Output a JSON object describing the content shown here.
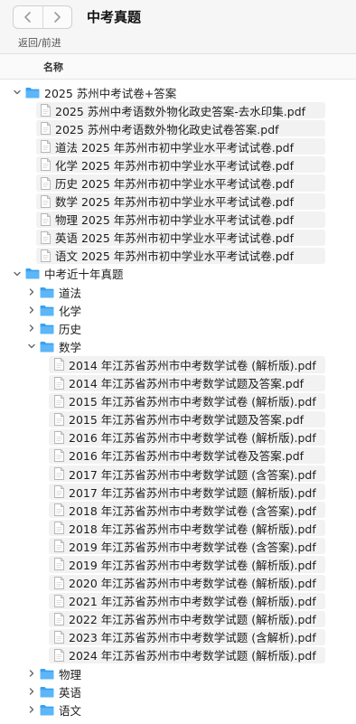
{
  "window": {
    "title": "中考真题",
    "nav_caption": "返回/前进"
  },
  "columns": {
    "name": "名称"
  },
  "icons": {
    "back": "chevron-left-icon",
    "forward": "chevron-right-icon",
    "folder": "folder-icon",
    "file": "pdf-file-icon",
    "expanded": "chevron-down-icon",
    "collapsed": "chevron-right-icon"
  },
  "colors": {
    "folder": "#3aa0f0",
    "stripe": "#f2f2f2"
  },
  "rows": [
    {
      "level": 0,
      "type": "folder",
      "expanded": true,
      "label": "2025 苏州中考试卷+答案"
    },
    {
      "level": 1,
      "type": "file",
      "label": "2025 苏州中考语数外物化政史答案-去水印集.pdf"
    },
    {
      "level": 1,
      "type": "file",
      "label": "2025 苏州中考语数外物化政史试卷答案.pdf"
    },
    {
      "level": 1,
      "type": "file",
      "label": "道法 2025 年苏州市初中学业水平考试试卷.pdf"
    },
    {
      "level": 1,
      "type": "file",
      "label": "化学 2025 年苏州市初中学业水平考试试卷.pdf"
    },
    {
      "level": 1,
      "type": "file",
      "label": "历史 2025 年苏州市初中学业水平考试试卷.pdf"
    },
    {
      "level": 1,
      "type": "file",
      "label": "数学 2025 年苏州市初中学业水平考试试卷.pdf"
    },
    {
      "level": 1,
      "type": "file",
      "label": "物理 2025 年苏州市初中学业水平考试试卷.pdf"
    },
    {
      "level": 1,
      "type": "file",
      "label": "英语 2025 年苏州市初中学业水平考试试卷.pdf"
    },
    {
      "level": 1,
      "type": "file",
      "label": "语文 2025 年苏州市初中学业水平考试试卷.pdf"
    },
    {
      "level": 0,
      "type": "folder",
      "expanded": true,
      "label": "中考近十年真题"
    },
    {
      "level": 1,
      "type": "folder",
      "expanded": false,
      "label": "道法"
    },
    {
      "level": 1,
      "type": "folder",
      "expanded": false,
      "label": "化学"
    },
    {
      "level": 1,
      "type": "folder",
      "expanded": false,
      "label": "历史"
    },
    {
      "level": 1,
      "type": "folder",
      "expanded": true,
      "label": "数学"
    },
    {
      "level": 2,
      "type": "file",
      "label": "2014 年江苏省苏州市中考数学试卷 (解析版).pdf"
    },
    {
      "level": 2,
      "type": "file",
      "label": "2014 年江苏省苏州市中考数学试题及答案.pdf"
    },
    {
      "level": 2,
      "type": "file",
      "label": "2015 年江苏省苏州市中考数学试卷 (解析版).pdf"
    },
    {
      "level": 2,
      "type": "file",
      "label": "2015 年江苏省苏州市中考数学试题及答案.pdf"
    },
    {
      "level": 2,
      "type": "file",
      "label": "2016 年江苏省苏州市中考数学试卷 (解析版).pdf"
    },
    {
      "level": 2,
      "type": "file",
      "label": "2016 年江苏省苏州市中考数学试卷及答案.pdf"
    },
    {
      "level": 2,
      "type": "file",
      "label": "2017 年江苏省苏州市中考数学试题 (含答案).pdf"
    },
    {
      "level": 2,
      "type": "file",
      "label": "2017 年江苏省苏州市中考数学试题 (解析版).pdf"
    },
    {
      "level": 2,
      "type": "file",
      "label": "2018 年江苏省苏州市中考数学试卷 (含答案).pdf"
    },
    {
      "level": 2,
      "type": "file",
      "label": "2018 年江苏省苏州市中考数学试卷 (解析版).pdf"
    },
    {
      "level": 2,
      "type": "file",
      "label": "2019 年江苏省苏州市中考数学试卷 (含答案).pdf"
    },
    {
      "level": 2,
      "type": "file",
      "label": "2019 年江苏省苏州市中考数学试卷 (解析版).pdf"
    },
    {
      "level": 2,
      "type": "file",
      "label": "2020 年江苏省苏州市中考数学试卷 (解析版).pdf"
    },
    {
      "level": 2,
      "type": "file",
      "label": "2021 年江苏省苏州市中考数学试卷 (解析版).pdf"
    },
    {
      "level": 2,
      "type": "file",
      "label": "2022 年江苏省苏州市中考数学试题 (解析版).pdf"
    },
    {
      "level": 2,
      "type": "file",
      "label": "2023 年江苏省苏州市中考数学试题 (含解析).pdf"
    },
    {
      "level": 2,
      "type": "file",
      "label": "2024 年江苏省苏州市中考数学试题 (解析版).pdf"
    },
    {
      "level": 1,
      "type": "folder",
      "expanded": false,
      "label": "物理"
    },
    {
      "level": 1,
      "type": "folder",
      "expanded": false,
      "label": "英语"
    },
    {
      "level": 1,
      "type": "folder",
      "expanded": false,
      "label": "语文"
    }
  ]
}
